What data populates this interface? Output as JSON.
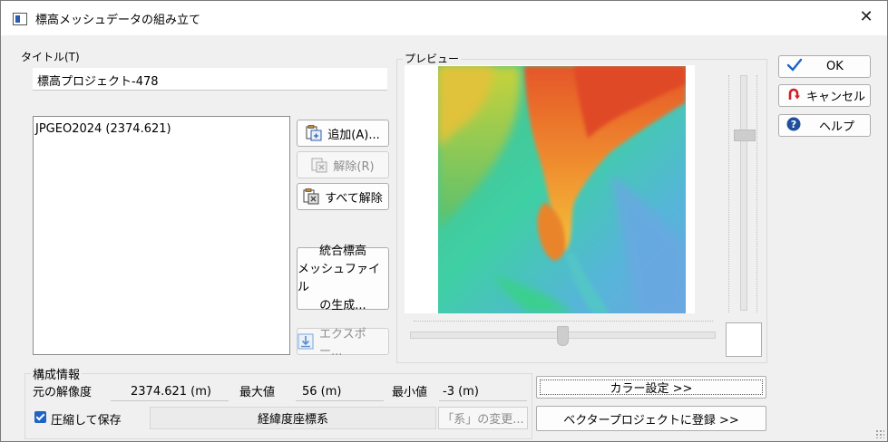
{
  "window": {
    "title": "標高メッシュデータの組み立て"
  },
  "title_section": {
    "label": "タイトル(T)",
    "value": "標高プロジェクト-478"
  },
  "mesh_list": {
    "items": [
      "JPGEO2024 (2374.621)"
    ]
  },
  "buttons": {
    "add": "追加(A)...",
    "remove": "解除(R)",
    "remove_all": "すべて解除",
    "generate_line1": "統合標高",
    "generate_line2": "メッシュファイル",
    "generate_line3": "の生成...",
    "export": "エクスポー...",
    "ok": "OK",
    "cancel": "キャンセル",
    "help": "ヘルプ",
    "color_settings": "カラー設定 >>",
    "register_vector": "ベクタープロジェクトに登録 >>",
    "change_system": "「系」の変更..."
  },
  "preview": {
    "label": "プレビュー"
  },
  "config": {
    "label": "構成情報",
    "resolution_label": "元の解像度",
    "resolution_value": "2374.621 (m)",
    "max_label": "最大値",
    "max_value": "56 (m)",
    "min_label": "最小値",
    "min_value": "-3 (m)",
    "compress_label": "圧縮して保存",
    "compress_checked": true,
    "coordinate_system": "経緯度座標系"
  },
  "colors": {
    "accent": "#1e63c6",
    "ok_check": "#1e63c6",
    "cancel_icon": "#d0202a",
    "help_icon": "#1f4f9c"
  }
}
